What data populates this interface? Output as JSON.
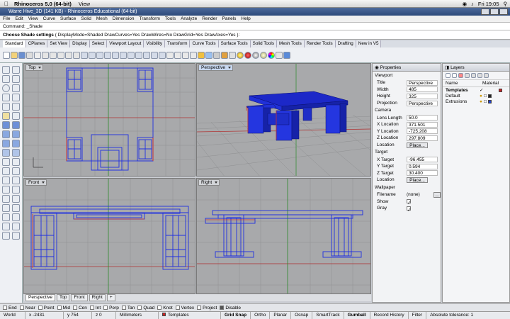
{
  "macbar": {
    "app": "Rhinoceros 5.0 (64-bit)",
    "menu": "View",
    "clock": "Fri 19:05"
  },
  "window": {
    "title": "Warre Hive_3D (141 KB) - Rhinoceros Educational (64-bit)"
  },
  "menu": [
    "File",
    "Edit",
    "View",
    "Curve",
    "Surface",
    "Solid",
    "Mesh",
    "Dimension",
    "Transform",
    "Tools",
    "Analyze",
    "Render",
    "Panels",
    "Help"
  ],
  "command": {
    "history": "Command: _Shade",
    "prompt": "Choose Shade settings",
    "options": "( DisplayMode=Shaded  DrawCurves=Yes  DrawWires=No  DrawGrid=Yes  DrawAxes=Yes ):"
  },
  "toolbar_tabs": [
    "Standard",
    "CPlanes",
    "Set View",
    "Display",
    "Select",
    "Viewport Layout",
    "Visibility",
    "Transform",
    "Curve Tools",
    "Surface Tools",
    "Solid Tools",
    "Mesh Tools",
    "Render Tools",
    "Drafting",
    "New in V5"
  ],
  "viewports": {
    "top": "Top",
    "perspective": "Perspective",
    "front": "Front",
    "right": "Right"
  },
  "viewport_tabs": [
    "Perspective",
    "Top",
    "Front",
    "Right"
  ],
  "properties": {
    "title": "Properties",
    "viewport_header": "Viewport",
    "viewport_rows": [
      {
        "k": "Title",
        "v": "Perspective"
      },
      {
        "k": "Width",
        "v": "485"
      },
      {
        "k": "Height",
        "v": "325"
      },
      {
        "k": "Projection",
        "v": "Perspective"
      }
    ],
    "camera_header": "Camera",
    "camera_rows": [
      {
        "k": "Lens Length",
        "v": "50.0"
      },
      {
        "k": "X Location",
        "v": "371.501"
      },
      {
        "k": "Y Location",
        "v": "-725.208"
      },
      {
        "k": "Z Location",
        "v": "297.809"
      }
    ],
    "location_label": "Location",
    "place_btn": "Place...",
    "target_header": "Target",
    "target_rows": [
      {
        "k": "X Target",
        "v": "-96.455"
      },
      {
        "k": "Y Target",
        "v": "0.594"
      },
      {
        "k": "Z Target",
        "v": "30.400"
      }
    ],
    "wallpaper_header": "Wallpaper",
    "filename_label": "Filename",
    "filename_value": "(none)",
    "browse": "...",
    "show_label": "Show",
    "gray_label": "Gray"
  },
  "layers": {
    "title": "Layers",
    "col_name": "Name",
    "col_material": "Material",
    "items": [
      {
        "name": "Templates",
        "color": "#cc2222"
      },
      {
        "name": "Default",
        "color": "#222222"
      },
      {
        "name": "Extrusions",
        "color": "#1f3fd0"
      }
    ]
  },
  "osnaps": [
    {
      "label": "End",
      "on": false
    },
    {
      "label": "Near",
      "on": false
    },
    {
      "label": "Point",
      "on": false
    },
    {
      "label": "Mid",
      "on": false
    },
    {
      "label": "Cen",
      "on": false
    },
    {
      "label": "Int",
      "on": false
    },
    {
      "label": "Perp",
      "on": false
    },
    {
      "label": "Tan",
      "on": false
    },
    {
      "label": "Quad",
      "on": false
    },
    {
      "label": "Knot",
      "on": false
    },
    {
      "label": "Vertex",
      "on": false
    },
    {
      "label": "Project",
      "on": false
    },
    {
      "label": "Disable",
      "on": true
    }
  ],
  "status": {
    "cplane": "World",
    "x": "x -2431",
    "y": "y 754",
    "z": "z 0",
    "units": "Millimeters",
    "layer": "Templates",
    "grid_snap": "Grid Snap",
    "ortho": "Ortho",
    "planar": "Planar",
    "osnap": "Osnap",
    "smarttrack": "SmartTrack",
    "gumball": "Gumball",
    "history": "Record History",
    "filter": "Filter",
    "tolerance": "Absolute tolerance: 1"
  },
  "colors": {
    "object": "#1f2fe0",
    "template": "#c83030",
    "grid": "#8f9092",
    "viewport_bg": "#a8a9ab"
  }
}
